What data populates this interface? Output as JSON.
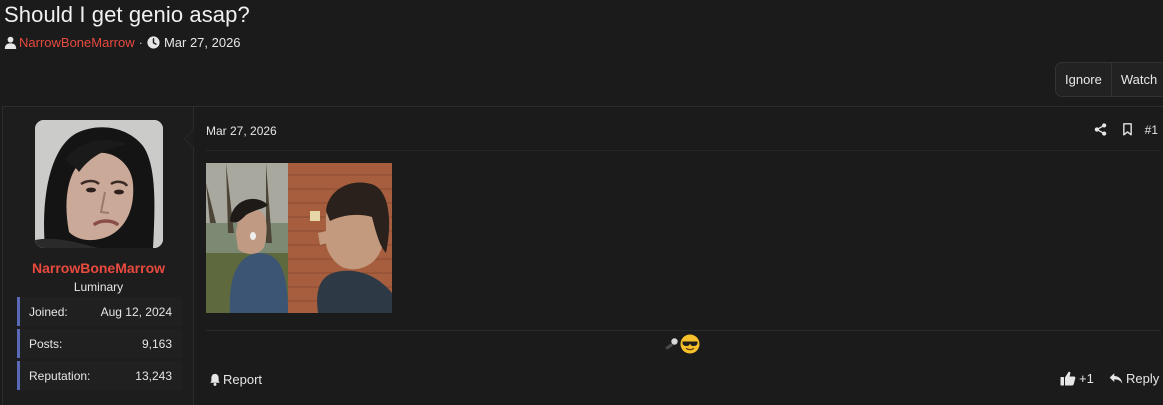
{
  "thread": {
    "title": "Should I get genio asap?",
    "author": "NarrowBoneMarrow",
    "separator": "·",
    "date": "Mar 27, 2026"
  },
  "header_buttons": {
    "ignore": "Ignore",
    "watch": "Watch"
  },
  "user": {
    "name": "NarrowBoneMarrow",
    "title": "Luminary",
    "stats": [
      {
        "label": "Joined:",
        "value": "Aug 12, 2024"
      },
      {
        "label": "Posts:",
        "value": "9,163"
      },
      {
        "label": "Reputation:",
        "value": "13,243"
      }
    ]
  },
  "post": {
    "date": "Mar 27, 2026",
    "number": "#1",
    "report_label": "Report",
    "like_label": "+1",
    "reply_label": "Reply"
  },
  "colors": {
    "accent_red": "#e84a3f",
    "stat_border": "#5969b8",
    "background": "#1b1b1b"
  }
}
